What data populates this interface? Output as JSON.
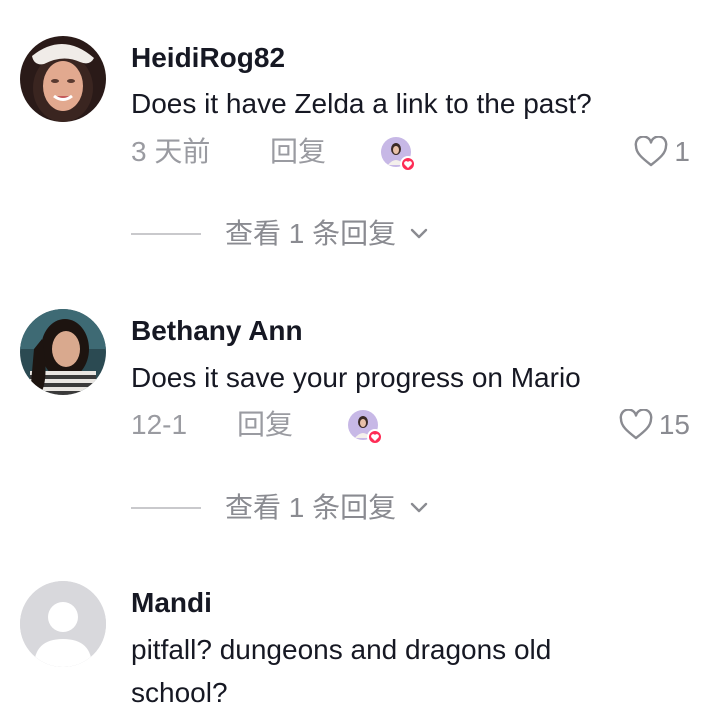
{
  "comments": [
    {
      "username": "HeidiRog82",
      "text": "Does it have Zelda a link to the past?",
      "time": "3 天前",
      "reply_label": "回复",
      "likes": "1",
      "view_replies": "查看 1 条回复"
    },
    {
      "username": "Bethany Ann",
      "text": "Does it save your progress on Mario",
      "time": "12-1",
      "reply_label": "回复",
      "likes": "15",
      "view_replies": "查看 1 条回复"
    },
    {
      "username": "Mandi",
      "text": "pitfall? dungeons and dragons old school?"
    }
  ],
  "colors": {
    "text": "#161823",
    "muted": "#9a9ba1",
    "badge": "#fe2c55",
    "default_avatar_bg": "#d8d8dc"
  },
  "icons": {
    "like": "heart-outline-icon",
    "expand": "chevron-down-icon",
    "creator_liked": "creator-liked-badge"
  }
}
